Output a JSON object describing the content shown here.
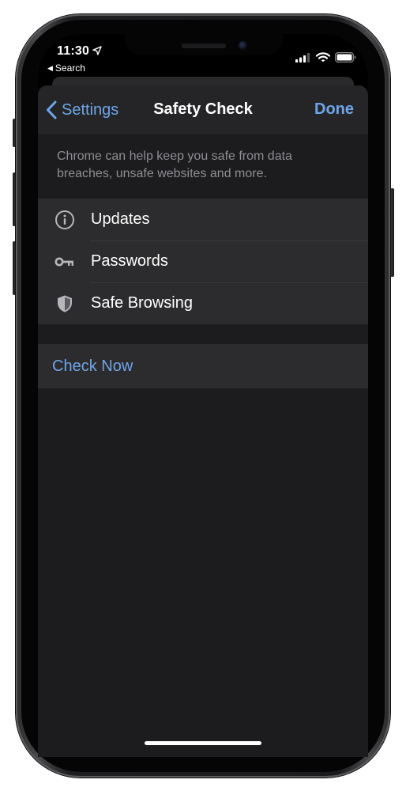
{
  "status_bar": {
    "time": "11:30",
    "back_app": "Search",
    "location_icon": "location-arrow-icon",
    "signal_icon": "cellular-signal-icon",
    "wifi_icon": "wifi-icon",
    "battery_icon": "battery-icon"
  },
  "nav": {
    "back_label": "Settings",
    "title": "Safety Check",
    "done_label": "Done",
    "back_icon": "chevron-left-icon"
  },
  "description": "Chrome can help keep you safe from data breaches, unsafe websites and more.",
  "items": [
    {
      "label": "Updates",
      "icon": "info-circle-icon"
    },
    {
      "label": "Passwords",
      "icon": "key-icon"
    },
    {
      "label": "Safe Browsing",
      "icon": "shield-icon"
    }
  ],
  "action": {
    "label": "Check Now"
  },
  "colors": {
    "accent": "#6ea5ea",
    "sheet_background": "#1c1c1e",
    "cell_background": "#2c2c2e",
    "secondary_text": "#8e8e93"
  }
}
